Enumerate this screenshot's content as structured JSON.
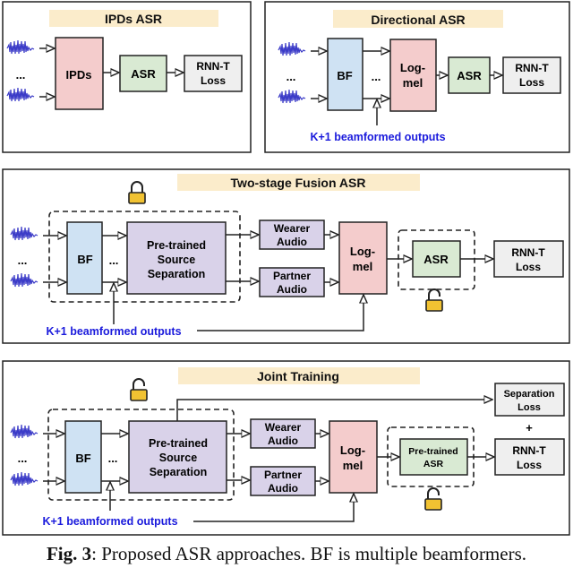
{
  "colors": {
    "title_bg": "#fbeccb",
    "pink": "#f4cccc",
    "green": "#d9ead3",
    "gray": "#efefef",
    "blue": "#cfe2f3",
    "purple": "#d9d2e9",
    "lock": "#f1c232",
    "wave": "#3c3cc8",
    "annotation": "#1a1adc"
  },
  "panels": {
    "ipds": {
      "title": "IPDs ASR",
      "ellipsis": "...",
      "ipds_block": "IPDs",
      "asr_block": "ASR",
      "loss_line1": "RNN-T",
      "loss_line2": "Loss"
    },
    "directional": {
      "title": "Directional ASR",
      "ellipsis": "...",
      "bf_block": "BF",
      "logmel_line1": "Log-",
      "logmel_line2": "mel",
      "asr_block": "ASR",
      "loss_line1": "RNN-T",
      "loss_line2": "Loss",
      "annotation": "K+1 beamformed outputs"
    },
    "two_stage": {
      "title": "Two-stage Fusion ASR",
      "ellipsis": "...",
      "bf_block": "BF",
      "sep_line1": "Pre-trained",
      "sep_line2": "Source",
      "sep_line3": "Separation",
      "wearer_line1": "Wearer",
      "wearer_line2": "Audio",
      "partner_line1": "Partner",
      "partner_line2": "Audio",
      "logmel_line1": "Log-",
      "logmel_line2": "mel",
      "asr_block": "ASR",
      "loss_line1": "RNN-T",
      "loss_line2": "Loss",
      "annotation": "K+1 beamformed outputs",
      "frontend_lock": "locked",
      "asr_lock": "unlocked"
    },
    "joint": {
      "title": "Joint Training",
      "ellipsis": "...",
      "bf_block": "BF",
      "sep_line1": "Pre-trained",
      "sep_line2": "Source",
      "sep_line3": "Separation",
      "wearer_line1": "Wearer",
      "wearer_line2": "Audio",
      "partner_line1": "Partner",
      "partner_line2": "Audio",
      "logmel_line1": "Log-",
      "logmel_line2": "mel",
      "asr_line1": "Pre-trained",
      "asr_line2": "ASR",
      "seploss_line1": "Separation",
      "seploss_line2": "Loss",
      "plus": "+",
      "loss_line1": "RNN-T",
      "loss_line2": "Loss",
      "annotation": "K+1 beamformed outputs",
      "frontend_lock": "unlocked",
      "asr_lock": "unlocked"
    }
  },
  "caption": {
    "label": "Fig. 3",
    "text": ": Proposed ASR approaches. BF is multiple beamformers."
  }
}
